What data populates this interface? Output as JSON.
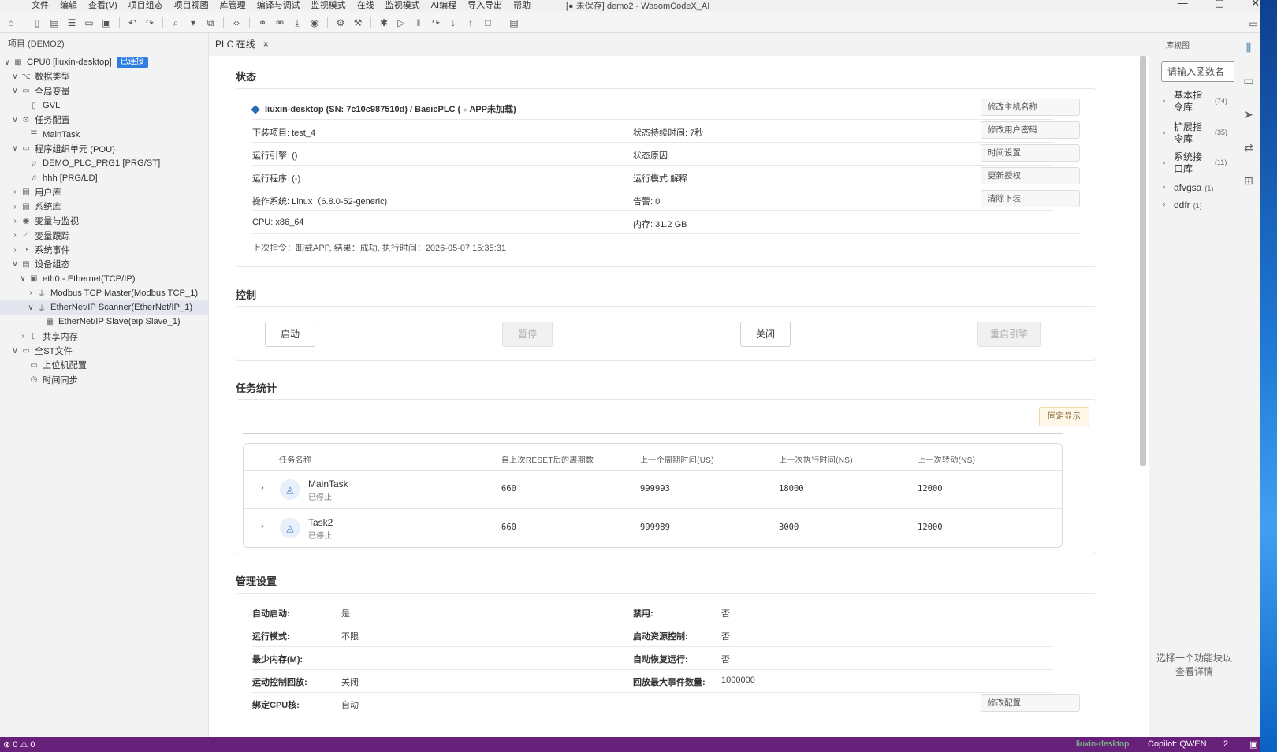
{
  "menu": [
    "文件",
    "编辑",
    "查看(V)",
    "项目组态",
    "项目视图",
    "库管理",
    "编译与调试",
    "监视模式",
    "在线",
    "监视模式",
    "AI编程",
    "导入导出",
    "帮助"
  ],
  "window_title": "[● 未保存] demo2 - WasomCodeX_AI",
  "left_panel": {
    "title": "项目 (DEMO2)",
    "tree": [
      {
        "label": "CPU0 [liuxin-desktop]",
        "indent": 0,
        "chev": "∨",
        "icon": "cpu-icon",
        "glyph": "▦",
        "badge": "已连接"
      },
      {
        "label": "数据类型",
        "indent": 1,
        "chev": "∨",
        "icon": "datatype-icon",
        "glyph": "⌥"
      },
      {
        "label": "全局变量",
        "indent": 1,
        "chev": "∨",
        "icon": "folder-icon",
        "glyph": "▭"
      },
      {
        "label": "GVL",
        "indent": 2,
        "chev": "",
        "icon": "file-icon",
        "glyph": "▯"
      },
      {
        "label": "任务配置",
        "indent": 1,
        "chev": "∨",
        "icon": "gear-icon",
        "glyph": "⚙"
      },
      {
        "label": "MainTask",
        "indent": 2,
        "chev": "",
        "icon": "list-icon",
        "glyph": "☰"
      },
      {
        "label": "程序组织单元 (POU)",
        "indent": 1,
        "chev": "∨",
        "icon": "folder-icon",
        "glyph": "▭"
      },
      {
        "label": "DEMO_PLC_PRG1 [PRG/ST]",
        "indent": 2,
        "chev": "",
        "icon": "program-icon",
        "glyph": "♫"
      },
      {
        "label": "hhh [PRG/LD]",
        "indent": 2,
        "chev": "",
        "icon": "program-icon",
        "glyph": "♫"
      },
      {
        "label": "用户库",
        "indent": 1,
        "chev": "›",
        "icon": "library-icon",
        "glyph": "▤"
      },
      {
        "label": "系统库",
        "indent": 1,
        "chev": "›",
        "icon": "library-icon",
        "glyph": "▤"
      },
      {
        "label": "变量与监视",
        "indent": 1,
        "chev": "›",
        "icon": "eye-icon",
        "glyph": "◉"
      },
      {
        "label": "变量跟踪",
        "indent": 1,
        "chev": "›",
        "icon": "chart-icon",
        "glyph": "⟋"
      },
      {
        "label": "系统事件",
        "indent": 1,
        "chev": "›",
        "icon": "bell-icon",
        "glyph": "◔"
      },
      {
        "label": "设备组态",
        "indent": 1,
        "chev": "∨",
        "icon": "device-icon",
        "glyph": "▤"
      },
      {
        "label": "eth0 - Ethernet(TCP/IP)",
        "indent": 2,
        "chev": "∨",
        "icon": "network-icon",
        "glyph": "▣"
      },
      {
        "label": "Modbus TCP Master(Modbus TCP_1)",
        "indent": 3,
        "chev": "›",
        "icon": "plug-icon",
        "glyph": "⏚"
      },
      {
        "label": "EtherNet/IP Scanner(EtherNet/IP_1)",
        "indent": 3,
        "chev": "∨",
        "icon": "plug-icon",
        "glyph": "⏚",
        "selected": true
      },
      {
        "label": "EtherNet/IP Slave(eip Slave_1)",
        "indent": 4,
        "chev": "",
        "icon": "module-icon",
        "glyph": "▦"
      },
      {
        "label": "共享内存",
        "indent": 2,
        "chev": "›",
        "icon": "memory-icon",
        "glyph": "▯"
      },
      {
        "label": "全ST文件",
        "indent": 1,
        "chev": "∨",
        "icon": "folder-icon",
        "glyph": "▭"
      },
      {
        "label": "上位机配置",
        "indent": 2,
        "chev": "",
        "icon": "monitor-icon",
        "glyph": "▭"
      },
      {
        "label": "时间同步",
        "indent": 2,
        "chev": "",
        "icon": "clock-icon",
        "glyph": "◷"
      }
    ]
  },
  "tab": {
    "label": "PLC 在线",
    "close": "×"
  },
  "status": {
    "section_title": "状态",
    "device_name": "liuxin-desktop (SN: 7c10c987510d) / BasicPLC (",
    "app_state": "APP未加载)",
    "rows_left": [
      {
        "label": "下装项目:",
        "value": " test_4"
      },
      {
        "label": "运行引擎:",
        "value": " ()"
      },
      {
        "label": "运行程序:",
        "value": " (-)"
      },
      {
        "label": "操作系统:",
        "value": " Linux（6.8.0-52-generic)"
      },
      {
        "label": "CPU:",
        "value": " x86_64"
      }
    ],
    "rows_right": [
      {
        "label": "状态持续时间:",
        "value": " 7秒"
      },
      {
        "label": "状态原因:",
        "value": ""
      },
      {
        "label": "运行模式:",
        "value": "解释"
      },
      {
        "label": "告警:",
        "value": " 0"
      },
      {
        "label": "内存:",
        "value": " 31.2 GB"
      }
    ],
    "buttons": [
      "修改主机名称",
      "修改用户密码",
      "时间设置",
      "更新授权",
      "清除下装"
    ],
    "last_cmd": "上次指令：卸载APP, 结果：成功, 执行时间：2026-05-07 15:35:31"
  },
  "control": {
    "section_title": "控制",
    "buttons": [
      {
        "label": "启动",
        "disabled": false
      },
      {
        "label": "暂停",
        "disabled": true
      },
      {
        "label": "关闭",
        "disabled": false
      },
      {
        "label": "重启引擎",
        "disabled": true
      }
    ]
  },
  "tasks": {
    "section_title": "任务统计",
    "fix_button": "固定显示",
    "headers": [
      "任务名称",
      "自上次RESET后的周期数",
      "上一个周期时间(US)",
      "上一次执行时间(NS)",
      "上一次转动(NS)"
    ],
    "rows": [
      {
        "name": "MainTask",
        "state": "已停止",
        "cycles": "660",
        "cycle_time": "999993",
        "exec_time": "18000",
        "jitter": "12000"
      },
      {
        "name": "Task2",
        "state": "已停止",
        "cycles": "660",
        "cycle_time": "999989",
        "exec_time": "3000",
        "jitter": "12000"
      }
    ]
  },
  "management": {
    "section_title": "管理设置",
    "left": [
      {
        "label": "自动启动:",
        "value": "是"
      },
      {
        "label": "运行模式:",
        "value": "不限"
      },
      {
        "label": "最少内存(M):",
        "value": ""
      },
      {
        "label": "运动控制回放:",
        "value": "关闭"
      },
      {
        "label": "绑定CPU核:",
        "value": "自动"
      }
    ],
    "right": [
      {
        "label": "禁用:",
        "value": "否"
      },
      {
        "label": "启动资源控制:",
        "value": "否"
      },
      {
        "label": "自动恢复运行:",
        "value": "否"
      },
      {
        "label": "回放最大事件数量:",
        "value": "1000000"
      }
    ],
    "modify_button": "修改配置"
  },
  "right_panel": {
    "title": "库视图",
    "search_placeholder": "请输入函数名",
    "libraries": [
      {
        "name": "基本指令库",
        "count": "(74)"
      },
      {
        "name": "扩展指令库",
        "count": "(35)"
      },
      {
        "name": "系统接口库",
        "count": "(11)"
      },
      {
        "name": "afvgsa",
        "count": "(1)"
      },
      {
        "name": "ddfr",
        "count": "(1)"
      }
    ],
    "hint": "选择一个功能块以查看详情"
  },
  "statusbar": {
    "problems": "⊗ 0 ⚠ 0",
    "connection": "liuxin-desktop",
    "copilot": "Copilot: QWEN",
    "notifications": "2"
  }
}
